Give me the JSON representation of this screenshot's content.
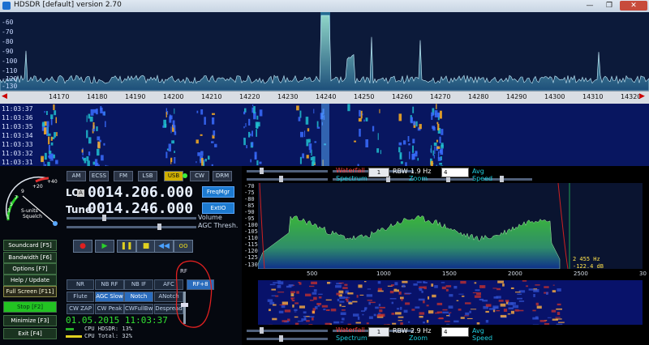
{
  "window": {
    "title": "HDSDR [default]  version 2.70",
    "min": "—",
    "max": "❐",
    "close": "✕"
  },
  "spectrum": {
    "db_labels": [
      "-60",
      "-70",
      "-80",
      "-90",
      "-100",
      "-110",
      "-120",
      "-130"
    ],
    "freq_labels": [
      "14170",
      "14180",
      "14190",
      "14200",
      "14210",
      "14220",
      "14230",
      "14240",
      "14250",
      "14260",
      "14270",
      "14280",
      "14290",
      "14300",
      "14310",
      "14320"
    ]
  },
  "waterfall": {
    "times": [
      "11:03:37",
      "11:03:36",
      "11:03:35",
      "11:03:34",
      "11:03:33",
      "11:03:32",
      "11:03:31"
    ]
  },
  "modes": [
    "AM",
    "ECSS",
    "FM",
    "LSB",
    "USB",
    "CW",
    "DRM"
  ],
  "lo": {
    "label": "LO",
    "tag": "A",
    "value": "0014.206.000"
  },
  "tune": {
    "label": "Tune",
    "value": "0014.246.000"
  },
  "buttons": {
    "freqmgr": "FreqMgr",
    "extio": "ExtIO"
  },
  "sliders": {
    "volume": "Volume",
    "agc": "AGC Thresh."
  },
  "smeter": {
    "label": "S-units",
    "sub": "Squelch",
    "ticks": [
      "+40",
      "+20",
      "9",
      "7",
      "5",
      "3",
      "1"
    ]
  },
  "side": [
    "Soundcard [F5]",
    "Bandwidth [F6]",
    "Options [F7]",
    "Help / Update [F1]",
    "Full Screen [F11]",
    "Stop [F2]",
    "Minimize [F3]",
    "Exit [F4]"
  ],
  "transport": [
    "●",
    "▶",
    "❚❚",
    "■",
    "◀◀",
    "oo"
  ],
  "nr": {
    "row1": [
      "NR",
      "NB RF",
      "NB IF",
      "AFC",
      "RF+8"
    ],
    "row2": [
      "Flute",
      "AGC Slow",
      "Notch",
      "ANotch"
    ],
    "row3": [
      "CW ZAP",
      "CW Peak",
      "CWFullBw",
      "Despread"
    ]
  },
  "rf_label": "RF",
  "datetime": "01.05.2015 11:03:37",
  "cpu": {
    "hdsdr": "CPU HDSDR: 13%",
    "total": "CPU Total: 32%"
  },
  "ctrl": {
    "waterfall": "Waterfall",
    "spectrum": "Spectrum",
    "rbw_label": "RBW",
    "rbw_top": "1.9 Hz",
    "rbw_bottom": "2.9 Hz",
    "zoom": "Zoom",
    "speed": "Speed",
    "avg": "Avg",
    "avg_val": "4",
    "box": "1"
  },
  "subspec": {
    "db": [
      "-70",
      "-75",
      "-80",
      "-85",
      "-90",
      "-95",
      "-100",
      "-105",
      "-110",
      "-115",
      "-120",
      "-125",
      "-130"
    ],
    "freqs": [
      "500",
      "1000",
      "1500",
      "2000",
      "2500",
      "30"
    ],
    "cursor_hz": "2 455 Hz",
    "cursor_db": "-122.4 dB"
  },
  "colors": {
    "accent": "#1d7ad0",
    "green": "#32e232",
    "red": "#ff4040",
    "cyan": "#20d0e0"
  }
}
